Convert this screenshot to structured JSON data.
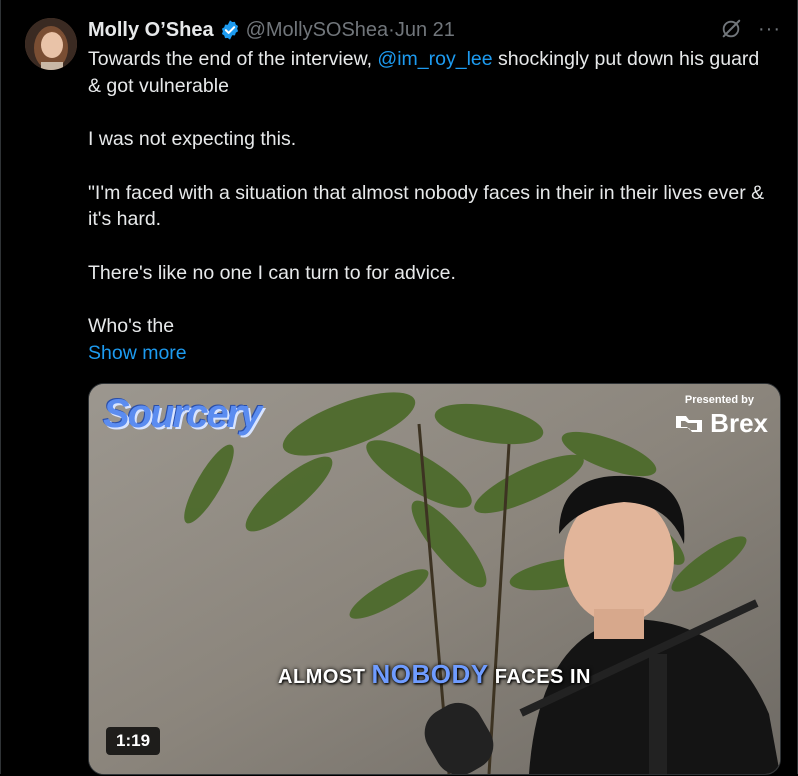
{
  "tweet": {
    "author_name": "Molly O’Shea",
    "handle": "@MollySOShea",
    "separator": " · ",
    "date": "Jun 21",
    "more_icon_label": "···",
    "text_line1_before": "Towards the end of the interview, ",
    "mention": "@im_roy_lee",
    "text_line1_after": " shockingly put down his guard & got vulnerable",
    "para2": "I was not expecting this.",
    "para3": "\"I'm faced with a situation that almost nobody faces in their in their lives ever & it's hard.",
    "para4": "There's like no one I can turn to for advice.",
    "para5": "Who's the",
    "show_more": "Show more"
  },
  "video": {
    "brand_title": "Sourcery",
    "presented_by": "Presented by",
    "sponsor": "Brex",
    "caption_before": "ALMOST ",
    "caption_highlight": "NOBODY",
    "caption_after": " FACES IN",
    "duration": "1:19"
  },
  "icons": {
    "verified": "verified-badge-icon",
    "grok": "grok-icon",
    "more": "more-options-icon"
  },
  "colors": {
    "background": "#000000",
    "text": "#e7e9ea",
    "muted": "#71767b",
    "link": "#1d9bf0",
    "verified": "#1d9bf0"
  }
}
